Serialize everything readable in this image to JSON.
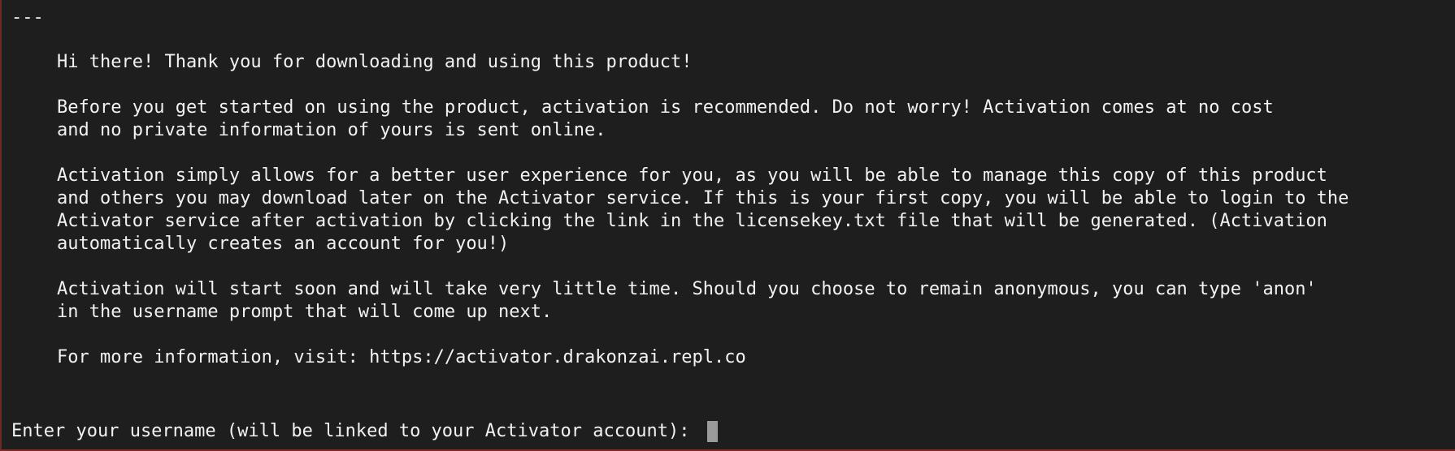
{
  "terminal": {
    "separator": "---",
    "lines": [
      "Hi there! Thank you for downloading and using this product!",
      "Before you get started on using the product, activation is recommended. Do not worry! Activation comes at no cost",
      "and no private information of yours is sent online.",
      "Activation simply allows for a better user experience for you, as you will be able to manage this copy of this product",
      "and others you may download later on the Activator service. If this is your first copy, you will be able to login to the",
      "Activator service after activation by clicking the link in the licensekey.txt file that will be generated. (Activation",
      "automatically creates an account for you!)",
      "Activation will start soon and will take very little time. Should you choose to remain anonymous, you can type 'anon'",
      "in the username prompt that will come up next.",
      "For more information, visit: https://activator.drakonzai.repl.co"
    ],
    "prompt": "Enter your username (will be linked to your Activator account): ",
    "input_value": "",
    "colors": {
      "background": "#1e1e1e",
      "text": "#f2f2f2",
      "cursor": "#9a9a9a",
      "border": "#6e2a22"
    }
  }
}
